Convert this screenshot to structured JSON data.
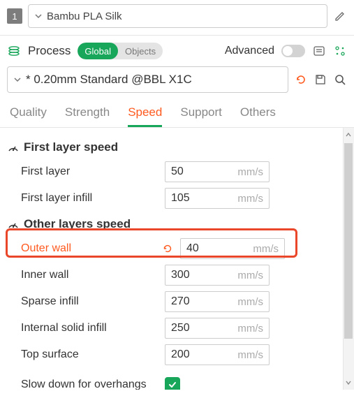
{
  "filament": {
    "index": "1",
    "name": "Bambu PLA Silk"
  },
  "process": {
    "label": "Process",
    "scope": {
      "global": "Global",
      "objects": "Objects"
    },
    "advanced_label": "Advanced",
    "preset": "* 0.20mm Standard @BBL X1C"
  },
  "tabs": {
    "quality": "Quality",
    "strength": "Strength",
    "speed": "Speed",
    "support": "Support",
    "others": "Others"
  },
  "groups": {
    "first_layer": {
      "title": "First layer speed",
      "rows": {
        "first_layer": {
          "label": "First layer",
          "value": "50",
          "unit": "mm/s"
        },
        "first_layer_infill": {
          "label": "First layer infill",
          "value": "105",
          "unit": "mm/s"
        }
      }
    },
    "other_layers": {
      "title": "Other layers speed",
      "rows": {
        "outer_wall": {
          "label": "Outer wall",
          "value": "40",
          "unit": "mm/s"
        },
        "inner_wall": {
          "label": "Inner wall",
          "value": "300",
          "unit": "mm/s"
        },
        "sparse_infill": {
          "label": "Sparse infill",
          "value": "270",
          "unit": "mm/s"
        },
        "internal_solid_infill": {
          "label": "Internal solid infill",
          "value": "250",
          "unit": "mm/s"
        },
        "top_surface": {
          "label": "Top surface",
          "value": "200",
          "unit": "mm/s"
        },
        "slow_overhangs": {
          "label": "Slow down for overhangs",
          "checked": true
        }
      }
    }
  }
}
